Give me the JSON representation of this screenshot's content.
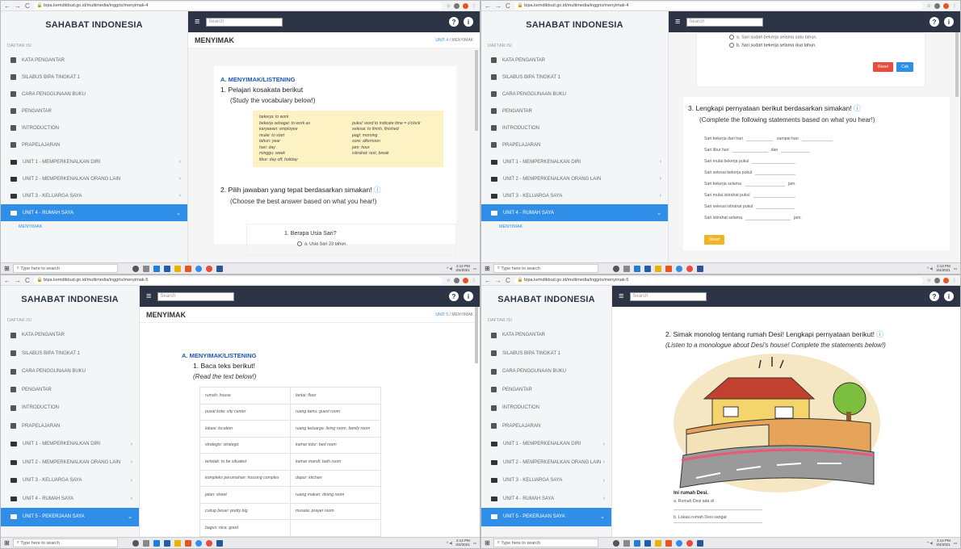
{
  "browser": {
    "url_q1": "bipa.kemdikbud.go.id/multimedia/inggris/menyimak-4",
    "url_q2": "bipa.kemdikbud.go.id/multimedia/inggris/menyimak-4",
    "url_q3": "bipa.kemdikbud.go.id/multimedia/inggris/menyimak-5",
    "url_q4": "bipa.kemdikbud.go.id/multimedia/inggris/menyimak-5"
  },
  "sidebar": {
    "brand": "SAHABAT INDONESIA",
    "toc_title": "DAFTAR ISI",
    "items": [
      {
        "label": "KATA PENGANTAR"
      },
      {
        "label": "SILABUS BIPA TINGKAT 1"
      },
      {
        "label": "CARA PENGGUNAAN BUKU"
      },
      {
        "label": "PENGANTAR"
      },
      {
        "label": "INTRODUCTION"
      },
      {
        "label": "PRAPELAJARAN"
      },
      {
        "label": "UNIT 1 - MEMPERKENALKAN DIRI"
      },
      {
        "label": "UNIT 2 - MEMPERKENALKAN ORANG LAIN"
      },
      {
        "label": "UNIT 3 - KELUARGA SAYA"
      },
      {
        "label": "UNIT 4 - RUMAH SAYA"
      },
      {
        "label": "UNIT 5 - PEKERJAAN SAYA"
      }
    ],
    "sub_item": "MENYIMAK"
  },
  "header": {
    "search_placeholder": "Search",
    "help_icon": "?",
    "info_icon": "i"
  },
  "q1": {
    "page_title": "MENYIMAK",
    "crumb_unit": "UNIT 4",
    "crumb_page": "MENYIMAK",
    "section": "A. MENYIMAK/LISTENING",
    "task1": "1. Pelajari kosakata berikut",
    "task1_en": "(Study the vocabulary below!)",
    "vocab_left": [
      "bekerja: to work",
      "bekerja sebagai: to work as",
      "karyawan: employee",
      "mulai: to start",
      "tahun: year",
      "hari: day",
      "minggu: week",
      "libur: day off, holiday"
    ],
    "vocab_right": [
      "pukul: word to indicate time = o'clock",
      "selesai: to finish, finished",
      "pagi: morning",
      "sore: afternoon",
      "jam: hour",
      "istirahat: rest, break"
    ],
    "task2": "2. Pilih jawaban yang tepat berdasarkan simakan!",
    "task2_en": "(Choose the best answer based on what you hear!)",
    "question": "1. Berapa Usia Sari?",
    "option_a": "a. Usia Sari 23 tahun."
  },
  "q2": {
    "option_a": "a. Sari sudah bekerja selama satu tahun.",
    "option_b": "b. Sari sudah bekerja selama dua tahun.",
    "reset": "Reset",
    "check": "Cek",
    "task3": "3. Lengkapi pernyataan berikut berdasarkan simakan!",
    "task3_en": "(Complete the following statements based on what you hear!)",
    "stmt1a": "Sari bekerja dari hari",
    "stmt1b": "sampai hari",
    "stmt2a": "Sari libur hari",
    "stmt2b": "dan",
    "stmt3": "Sari mulai bekerja pukul",
    "stmt4": "Sari selesai bekerja pukul",
    "stmt5a": "Sari bekerja selama",
    "stmt5b": "jam.",
    "stmt6": "Sari mulai istirahat pukul",
    "stmt7": "Sari selesai istirahat pukul",
    "stmt8a": "Sari istirahat selama",
    "stmt8b": "jam.",
    "reset2": "Reset"
  },
  "q3": {
    "page_title": "MENYIMAK",
    "crumb_unit": "UNIT 5",
    "crumb_page": "MENYIMAK",
    "section": "A. MENYIMAK/LISTENING",
    "task1": "1. Baca teks berikut!",
    "task1_en": "(Read the text below!)",
    "rows": [
      [
        "rumah: house",
        "lantai: floor"
      ],
      [
        "pusat kota: city center",
        "ruang tamu: guest room"
      ],
      [
        "lokasi: location",
        "ruang keluarga: living room, family room"
      ],
      [
        "strategis: strategic",
        "kamar tidur: bed room"
      ],
      [
        "terletak: to be situated",
        "kamar mandi: bath room"
      ],
      [
        "kompleks perumahan: housing complex",
        "dapur: kitchen"
      ],
      [
        "jalan: street",
        "ruang makan: dining room"
      ],
      [
        "cukup besar: pretty big",
        "musala: prayer room"
      ],
      [
        "bagus: nice, good",
        ""
      ]
    ]
  },
  "q4": {
    "task2": "2. Simak monolog tentang rumah Desi! Lengkapi pernyataan berikut!",
    "task2_en": "(Listen to a monologue about Desi's house! Complete the statements below!)",
    "caption": "Ini rumah Desi.",
    "stmt_a": "a. Rumah Desi ada di",
    "stmt_b": "b. Lokasi rumah Desi sangat"
  },
  "taskbar": {
    "search": "Type here to search",
    "time_q1": "2:12 PM",
    "date_q1": "3/4/2021",
    "time_q2": "2:13 PM",
    "date_q2": "3/4/2021",
    "time_q3": "2:14 PM",
    "date_q3": "3/4/2021",
    "time_q4": "2:14 PM",
    "date_q4": "3/4/2021"
  },
  "colors": {
    "sidebar_active": "#2f8fe8",
    "topbar": "#2c3446",
    "heading_blue": "#1a56b7",
    "vocab_bg": "#fdf2c4",
    "reset_red": "#e74c3c",
    "check_blue": "#2f8fe8",
    "reset_yellow": "#f0b429"
  }
}
